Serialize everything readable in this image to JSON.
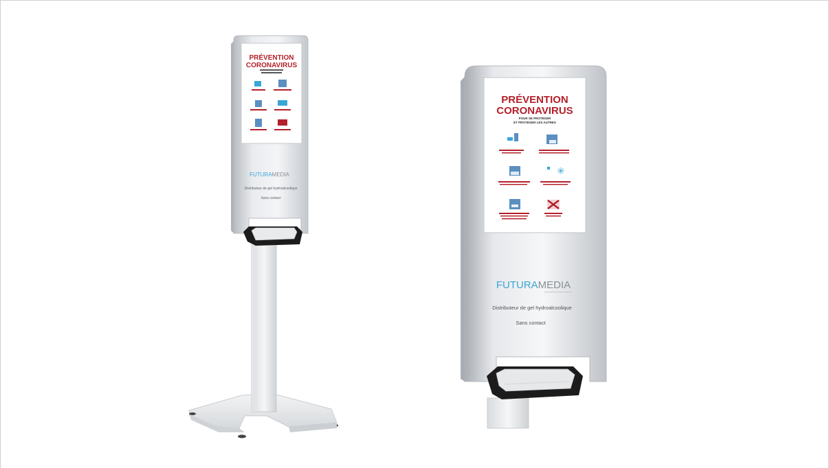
{
  "kiosks": {
    "small": {
      "poster": {
        "title_line1": "PRÉVENTION",
        "title_line2": "CORONAVIRUS"
      },
      "brand": {
        "part1": "FUTURA",
        "part2": "MEDIA"
      },
      "caption": "Distributeur de gel hydroalcoolique",
      "subcaption": "Sans contact"
    },
    "large": {
      "poster": {
        "title_line1": "PRÉVENTION",
        "title_line2": "CORONAVIRUS",
        "subtitle_line1": "POUR SE PROTÉGER",
        "subtitle_line2": "ET PROTÉGER LES AUTRES"
      },
      "brand": {
        "part1": "FUTURA",
        "part2": "MEDIA"
      },
      "caption": "Distributeur de gel hydroalcoolique",
      "subcaption": "Sans contact"
    }
  },
  "colors": {
    "brand_blue": "#3aa6d6",
    "brand_grey": "#8a8f96",
    "poster_red": "#b3202a",
    "device_silver": "#dcdfe3",
    "bezel_black": "#1c1c1c"
  }
}
